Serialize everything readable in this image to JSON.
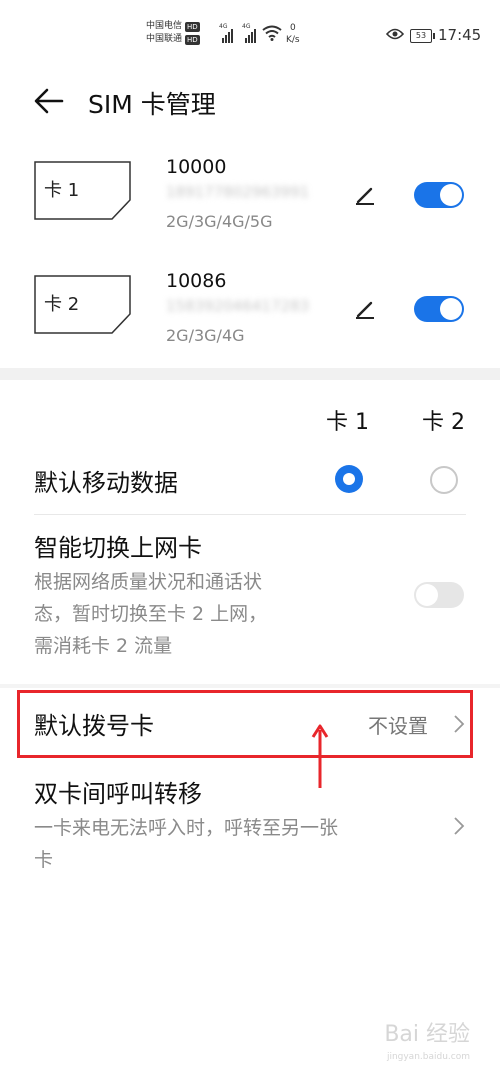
{
  "status_bar": {
    "carrier1": "中国电信",
    "carrier2": "中国联通",
    "hd": "HD",
    "net1": "4G",
    "net2": "4G",
    "speed_value": "0",
    "speed_unit": "K/s",
    "battery": "53",
    "time": "17:45"
  },
  "header": {
    "title": "SIM 卡管理"
  },
  "sim_cards": [
    {
      "card_label": "卡 1",
      "name": "10000",
      "number": "189177802963991",
      "networks": "2G/3G/4G/5G",
      "enabled": true
    },
    {
      "card_label": "卡 2",
      "name": "10086",
      "number": "158392046417283",
      "networks": "2G/3G/4G",
      "enabled": true
    }
  ],
  "column_headers": {
    "card1": "卡 1",
    "card2": "卡 2"
  },
  "default_mobile_data": {
    "label": "默认移动数据",
    "selected": "卡 1"
  },
  "smart_switch": {
    "title": "智能切换上网卡",
    "desc_line1": "根据网络质量状况和通话状",
    "desc_line2": "态，暂时切换至卡 2 上网，",
    "desc_line3": "需消耗卡 2 流量",
    "enabled": false
  },
  "default_dial": {
    "label": "默认拨号卡",
    "value": "不设置"
  },
  "call_forward": {
    "title": "双卡间呼叫转移",
    "desc_line1": "一卡来电无法呼入时，呼转至另一张",
    "desc_line2": "卡"
  },
  "watermark": {
    "main": "Bai 经验",
    "sub": "jingyan.baidu.com"
  },
  "colors": {
    "accent": "#1a74e8",
    "highlight": "#e8262b",
    "toggle_off": "#e6e6e6"
  },
  "icons": [
    "back-arrow-icon",
    "edit-pencil-icon",
    "chevron-right-icon",
    "wifi-icon",
    "eye-icon",
    "battery-icon",
    "signal-icon"
  ]
}
